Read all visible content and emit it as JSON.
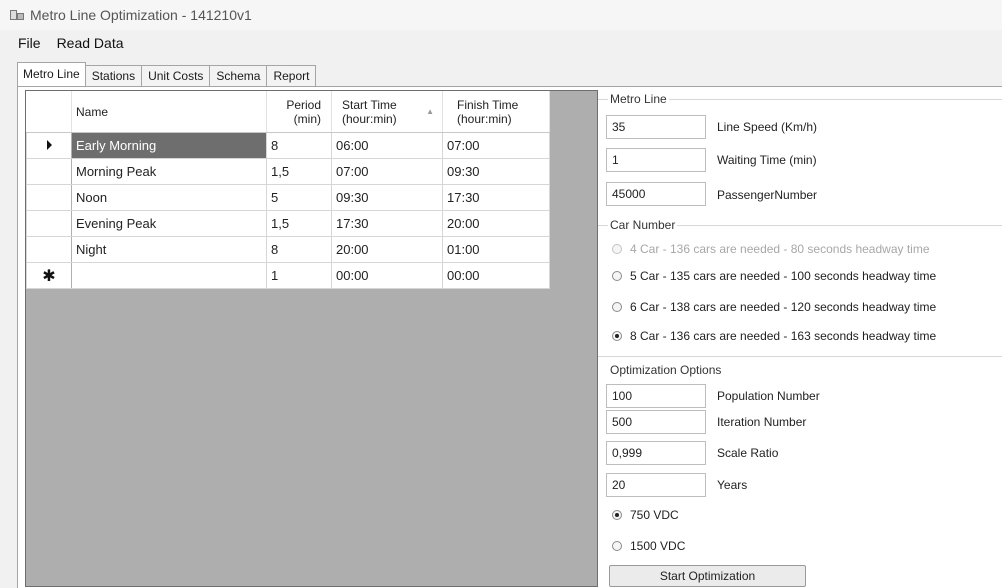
{
  "window": {
    "title": "Metro Line Optimization - 141210v1"
  },
  "menu": {
    "items": [
      "File",
      "Read Data"
    ]
  },
  "tabs": [
    "Metro Line",
    "Stations",
    "Unit Costs",
    "Schema",
    "Report"
  ],
  "grid": {
    "headers": {
      "name": "Name",
      "period": "Period (min)",
      "start": "Start Time (hour:min)",
      "finish": "Finish Time (hour:min)"
    },
    "rows": [
      {
        "name": "Early Morning",
        "period": "8",
        "start": "06:00",
        "finish": "07:00"
      },
      {
        "name": "Morning Peak",
        "period": "1,5",
        "start": "07:00",
        "finish": "09:30"
      },
      {
        "name": "Noon",
        "period": "5",
        "start": "09:30",
        "finish": "17:30"
      },
      {
        "name": "Evening Peak",
        "period": "1,5",
        "start": "17:30",
        "finish": "20:00"
      },
      {
        "name": "Night",
        "period": "8",
        "start": "20:00",
        "finish": "01:00"
      }
    ],
    "new_row": {
      "name": "",
      "period": "1",
      "start": "00:00",
      "finish": "00:00"
    }
  },
  "metro_line": {
    "title": "Metro Line",
    "line_speed": {
      "value": "35",
      "label": "Line Speed (Km/h)"
    },
    "waiting_time": {
      "value": "1",
      "label": "Waiting Time (min)"
    },
    "passenger_number": {
      "value": "45000",
      "label": "PassengerNumber"
    }
  },
  "car_number": {
    "title": "Car Number",
    "options": [
      {
        "label": "4 Car - 136 cars are needed - 80 seconds headway time",
        "checked": false,
        "disabled": true
      },
      {
        "label": "5 Car - 135 cars are needed - 100 seconds headway time",
        "checked": false,
        "disabled": false
      },
      {
        "label": "6 Car - 138 cars are needed - 120 seconds headway time",
        "checked": false,
        "disabled": false
      },
      {
        "label": "8 Car - 136 cars are needed - 163 seconds headway time",
        "checked": true,
        "disabled": false
      }
    ]
  },
  "optimization": {
    "title": "Optimization Options",
    "population": {
      "value": "100",
      "label": "Population Number"
    },
    "iteration": {
      "value": "500",
      "label": "Iteration Number"
    },
    "scale_ratio": {
      "value": "0,999",
      "label": "Scale Ratio"
    },
    "years": {
      "value": "20",
      "label": "Years"
    },
    "voltage": [
      {
        "label": "750 VDC",
        "checked": true
      },
      {
        "label": "1500 VDC",
        "checked": false
      }
    ],
    "start_button": "Start Optimization"
  }
}
